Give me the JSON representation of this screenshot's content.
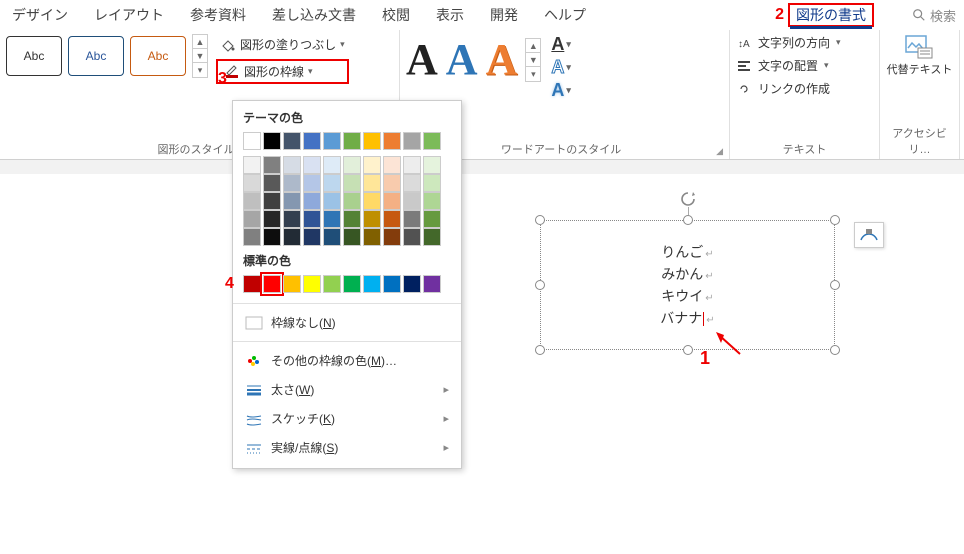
{
  "menu": {
    "items": [
      "デザイン",
      "レイアウト",
      "参考資料",
      "差し込み文書",
      "校閲",
      "表示",
      "開発",
      "ヘルプ"
    ],
    "selected": "図形の書式",
    "search_placeholder": "検索"
  },
  "callouts": {
    "c1": "1",
    "c2": "2",
    "c3": "3",
    "c4": "4"
  },
  "ribbon": {
    "shape_styles": {
      "thumb_label": "Abc",
      "fill_label": "図形の塗りつぶし",
      "outline_label": "図形の枠線",
      "group_label": "図形のスタイル"
    },
    "wordart": {
      "glyph": "A",
      "group_label": "ワードアートのスタイル"
    },
    "text": {
      "direction": "文字列の方向",
      "align": "文字の配置",
      "link": "リンクの作成",
      "group_label": "テキスト"
    },
    "alttext": {
      "label": "代替テキスト",
      "group_label": "アクセシビリ…"
    }
  },
  "dropdown": {
    "theme_header": "テーマの色",
    "theme_colors_row1": [
      "#ffffff",
      "#000000",
      "#44546a",
      "#4472c4",
      "#5b9bd5",
      "#70ad47",
      "#ffc000",
      "#ed7d31",
      "#a5a5a5",
      "#7cbb59"
    ],
    "theme_shades": [
      [
        "#f2f2f2",
        "#808080",
        "#d6dce5",
        "#d9e1f2",
        "#deebf7",
        "#e2efda",
        "#fff2cc",
        "#fce4d6",
        "#ededed",
        "#e5f3dd"
      ],
      [
        "#d9d9d9",
        "#595959",
        "#adb9ca",
        "#b4c6e7",
        "#bdd7ee",
        "#c6e0b4",
        "#ffe699",
        "#f8cbad",
        "#dbdbdb",
        "#cde8bd"
      ],
      [
        "#bfbfbf",
        "#404040",
        "#8497b0",
        "#8ea9db",
        "#9bc2e6",
        "#a9d08e",
        "#ffd966",
        "#f4b084",
        "#c9c9c9",
        "#aed694"
      ],
      [
        "#a6a6a6",
        "#262626",
        "#333f4f",
        "#305496",
        "#2f75b5",
        "#548235",
        "#bf8f00",
        "#c65911",
        "#7b7b7b",
        "#669a3f"
      ],
      [
        "#808080",
        "#0d0d0d",
        "#222b35",
        "#203764",
        "#1f4e78",
        "#375623",
        "#806000",
        "#833c0c",
        "#525252",
        "#43682a"
      ]
    ],
    "standard_header": "標準の色",
    "standard_colors": [
      "#c00000",
      "#ff0000",
      "#ffc000",
      "#ffff00",
      "#92d050",
      "#00b050",
      "#00b0f0",
      "#0070c0",
      "#002060",
      "#7030a0"
    ],
    "no_outline": "枠線なし(N)",
    "more_colors": "その他の枠線の色(M)…",
    "weight": "太さ(W)",
    "sketch": "スケッチ(K)",
    "dashes": "実線/点線(S)"
  },
  "textbox": {
    "lines": [
      "りんご",
      "みかん",
      "キウイ",
      "バナナ"
    ]
  }
}
